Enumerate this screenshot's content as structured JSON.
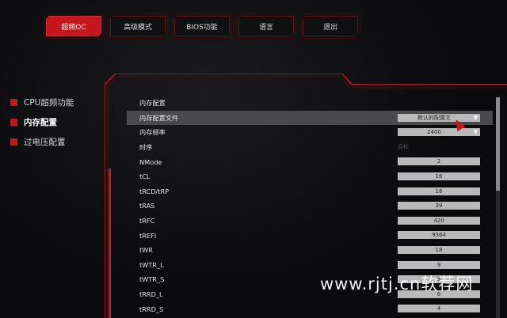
{
  "nav": {
    "tabs": [
      {
        "label": "超频OC",
        "active": true
      },
      {
        "label": "高级模式",
        "active": false
      },
      {
        "label": "BIOS功能",
        "active": false
      },
      {
        "label": "语言",
        "active": false
      },
      {
        "label": "退出",
        "active": false
      }
    ]
  },
  "sidebar": {
    "items": [
      {
        "label": "CPU超频功能",
        "active": false
      },
      {
        "label": "内存配置",
        "active": true
      },
      {
        "label": "过电压配置",
        "active": false
      }
    ]
  },
  "panel": {
    "section_title": "内存配置",
    "profile": {
      "label": "内存配置文件",
      "value": "默认的配置文"
    },
    "frequency": {
      "label": "内存频率",
      "value": "2400"
    },
    "timing": {
      "label": "时序",
      "target": "目标"
    },
    "timings": [
      {
        "label": "NMode",
        "value": "2"
      },
      {
        "label": "tCL",
        "value": "16"
      },
      {
        "label": "tRCD/tRP",
        "value": "16"
      },
      {
        "label": "tRAS",
        "value": "39"
      },
      {
        "label": "tRFC",
        "value": "420"
      },
      {
        "label": "tREFI",
        "value": "9364"
      },
      {
        "label": "tWR",
        "value": "18"
      },
      {
        "label": "tWTR_L",
        "value": "9"
      },
      {
        "label": "tWTR_S",
        "value": "3"
      },
      {
        "label": "tRRD_L",
        "value": "6"
      },
      {
        "label": "tRRD_S",
        "value": "4"
      }
    ]
  },
  "watermark": "www.rjtj.cn软荐网",
  "colors": {
    "accent": "#c4161c",
    "highlight_row": "#4a4a4c",
    "value_box": "#b9b9b9"
  }
}
